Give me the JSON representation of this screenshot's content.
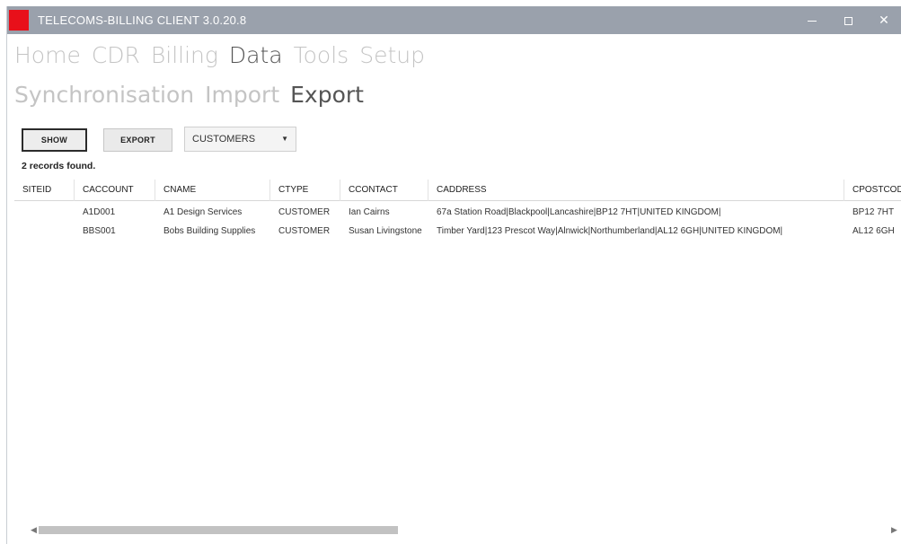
{
  "window": {
    "title": "TELECOMS-BILLING CLIENT 3.0.20.8",
    "logo_color": "#e8101a",
    "titlebar_color": "#9aa1ac",
    "minimize_icon": "—",
    "maximize_icon": "",
    "close_icon": "✕"
  },
  "main_menu": [
    "Home",
    "CDR",
    "Billing",
    "Data",
    "Tools",
    "Setup"
  ],
  "main_menu_active": "Data",
  "sub_menu": [
    "Synchronisation",
    "Import",
    "Export"
  ],
  "sub_menu_active": "Export",
  "toolbar": {
    "show_label": "SHOW",
    "export_label": "EXPORT",
    "dataset_selected": "CUSTOMERS",
    "dataset_arrow": "▼"
  },
  "status": {
    "records_found": "2 records found."
  },
  "grid": {
    "columns": [
      "SITEID",
      "CACCOUNT",
      "CNAME",
      "CTYPE",
      "CCONTACT",
      "CADDRESS",
      "CPOSTCODE"
    ],
    "rows": [
      [
        "",
        "A1D001",
        "A1 Design Services",
        "CUSTOMER",
        "Ian Cairns",
        "67a Station Road|Blackpool|Lancashire|BP12 7HT|UNITED KINGDOM|",
        "BP12 7HT"
      ],
      [
        "",
        "BBS001",
        "Bobs Building Supplies",
        "CUSTOMER",
        "Susan Livingstone",
        "Timber Yard|123 Prescot Way|Alnwick|Northumberland|AL12 6GH|UNITED KINGDOM|",
        "AL12 6GH"
      ]
    ]
  },
  "scrollbar": {
    "left_arrow": "◀",
    "right_arrow": "▶"
  }
}
